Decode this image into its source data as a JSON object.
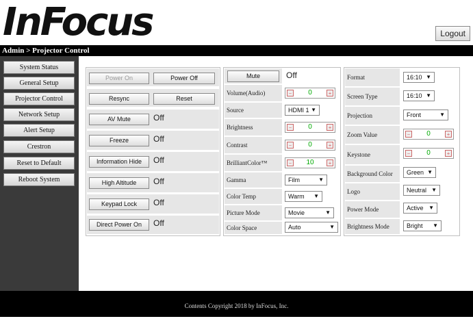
{
  "header": {
    "logo_text": "InFocus",
    "logout_label": "Logout",
    "breadcrumb": "Admin > Projector Control"
  },
  "sidebar": {
    "items": [
      {
        "label": "System Status"
      },
      {
        "label": "General Setup"
      },
      {
        "label": "Projector Control"
      },
      {
        "label": "Network Setup"
      },
      {
        "label": "Alert Setup"
      },
      {
        "label": "Crestron"
      },
      {
        "label": "Reset to Default"
      },
      {
        "label": "Reboot System"
      }
    ]
  },
  "power": {
    "on_label": "Power On",
    "off_label": "Power Off",
    "resync_label": "Resync",
    "reset_label": "Reset"
  },
  "toggles": [
    {
      "label": "AV Mute",
      "state": "Off"
    },
    {
      "label": "Freeze",
      "state": "Off"
    },
    {
      "label": "Information Hide",
      "state": "Off"
    },
    {
      "label": "High Altitude",
      "state": "Off"
    },
    {
      "label": "Keypad Lock",
      "state": "Off"
    },
    {
      "label": "Direct Power On",
      "state": "Off"
    }
  ],
  "middle": {
    "mute_label": "Mute",
    "mute_state": "Off",
    "volume_label": "Volume(Audio)",
    "volume": "0",
    "source_label": "Source",
    "source": "HDMI 1",
    "brightness_label": "Brightness",
    "brightness": "0",
    "contrast_label": "Contrast",
    "contrast": "0",
    "brilliant_label": "BrilliantColor™",
    "brilliant": "10",
    "gamma_label": "Gamma",
    "gamma": "Film",
    "colortemp_label": "Color Temp",
    "colortemp": "Warm",
    "picture_label": "Picture Mode",
    "picture": "Movie",
    "colorspace_label": "Color Space",
    "colorspace": "Auto"
  },
  "right": {
    "format_label": "Format",
    "format": "16:10",
    "screen_label": "Screen Type",
    "screen": "16:10",
    "projection_label": "Projection",
    "projection": "Front",
    "zoom_label": "Zoom Value",
    "zoom": "0",
    "keystone_label": "Keystone",
    "keystone": "0",
    "bg_label": "Background Color",
    "bg": "Green",
    "logo_label": "Logo",
    "logo": "Neutral",
    "powermode_label": "Power Mode",
    "powermode": "Active",
    "brightmode_label": "Brightness Mode",
    "brightmode": "Bright"
  },
  "icons": {
    "minus": "−",
    "plus": "+",
    "arrow": "▼"
  },
  "footer": {
    "text": "Contents Copyright 2018 by InFocus, Inc."
  }
}
